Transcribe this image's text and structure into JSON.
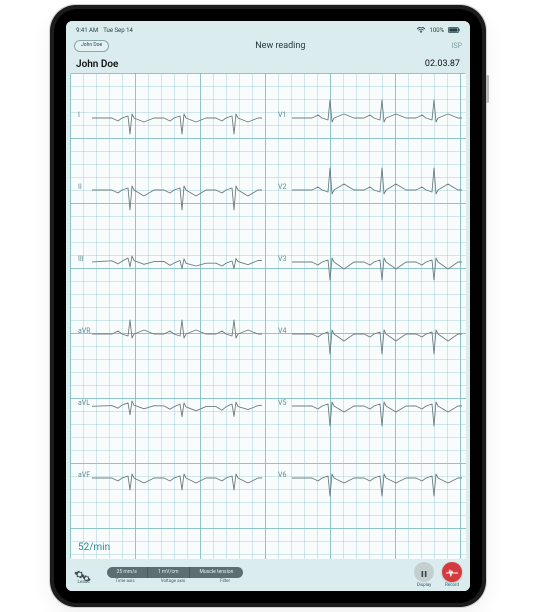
{
  "status": {
    "time": "9:41 AM",
    "date": "Tue Sep 14",
    "battery": "100%"
  },
  "nav": {
    "back": "John Doe",
    "title": "New reading",
    "right": "ISP"
  },
  "patient": {
    "name": "John Doe",
    "date": "02.03.87"
  },
  "leads": [
    "I",
    "II",
    "III",
    "aVR",
    "aVL",
    "aVF",
    "V1",
    "V2",
    "V3",
    "V4",
    "V5",
    "V6"
  ],
  "bpm": "52/min",
  "toolbar": {
    "leads_label": "Leads",
    "seg": {
      "time_axis": "25 mm/s",
      "voltage": "1 mV/cm",
      "filter_mode": "Muscle tension"
    },
    "seg_labels": {
      "time": "Time axis",
      "voltage": "Voltage axis",
      "filter": "Filter"
    },
    "display": "Display",
    "record": "Record"
  },
  "colors": {
    "accent": "#2b8a92",
    "record": "#d53a3f",
    "grid": "#7ababf"
  }
}
